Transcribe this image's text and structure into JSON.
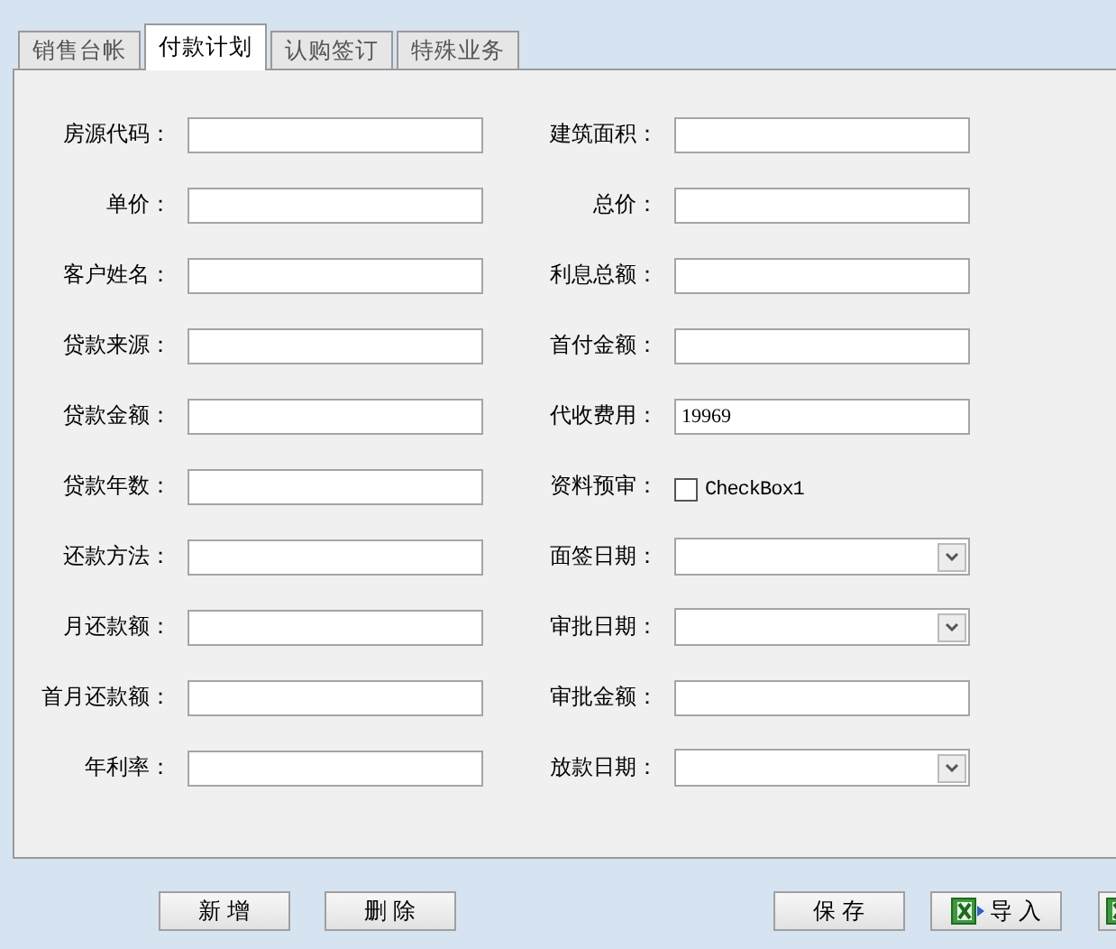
{
  "tabs": [
    {
      "label": "销售台帐",
      "selected": false
    },
    {
      "label": "付款计划",
      "selected": true
    },
    {
      "label": "认购签订",
      "selected": false
    },
    {
      "label": "特殊业务",
      "selected": false
    }
  ],
  "columns": [
    {
      "fields": [
        {
          "label": "房源代码：",
          "kind": "text"
        },
        {
          "label": "单价：",
          "kind": "text"
        },
        {
          "label": "客户姓名：",
          "kind": "text"
        },
        {
          "label": "贷款来源：",
          "kind": "text"
        },
        {
          "label": "贷款金额：",
          "kind": "text"
        },
        {
          "label": "贷款年数：",
          "kind": "text"
        },
        {
          "label": "还款方法：",
          "kind": "text"
        },
        {
          "label": "月还款额：",
          "kind": "text"
        },
        {
          "label": "首月还款额：",
          "kind": "text"
        },
        {
          "label": "年利率：",
          "kind": "text"
        }
      ]
    },
    {
      "fields": [
        {
          "label": "建筑面积：",
          "kind": "text"
        },
        {
          "label": "总价：",
          "kind": "text"
        },
        {
          "label": "利息总额：",
          "kind": "text"
        },
        {
          "label": "首付金额：",
          "kind": "text"
        },
        {
          "label": "代收费用：",
          "kind": "text",
          "value": "19969"
        },
        {
          "label": "资料预审：",
          "kind": "checkbox",
          "caption": "CheckBox1",
          "checked": false
        },
        {
          "label": "面签日期：",
          "kind": "select"
        },
        {
          "label": "审批日期：",
          "kind": "select"
        },
        {
          "label": "审批金额：",
          "kind": "text"
        },
        {
          "label": "放款日期：",
          "kind": "select"
        }
      ]
    }
  ],
  "buttons": [
    {
      "label": "新 增",
      "kind": "plain"
    },
    {
      "label": "删 除",
      "kind": "plain"
    },
    {
      "label": "保 存",
      "kind": "plain"
    },
    {
      "label": "导 入",
      "kind": "excel"
    },
    {
      "kind": "excel-cut"
    }
  ]
}
